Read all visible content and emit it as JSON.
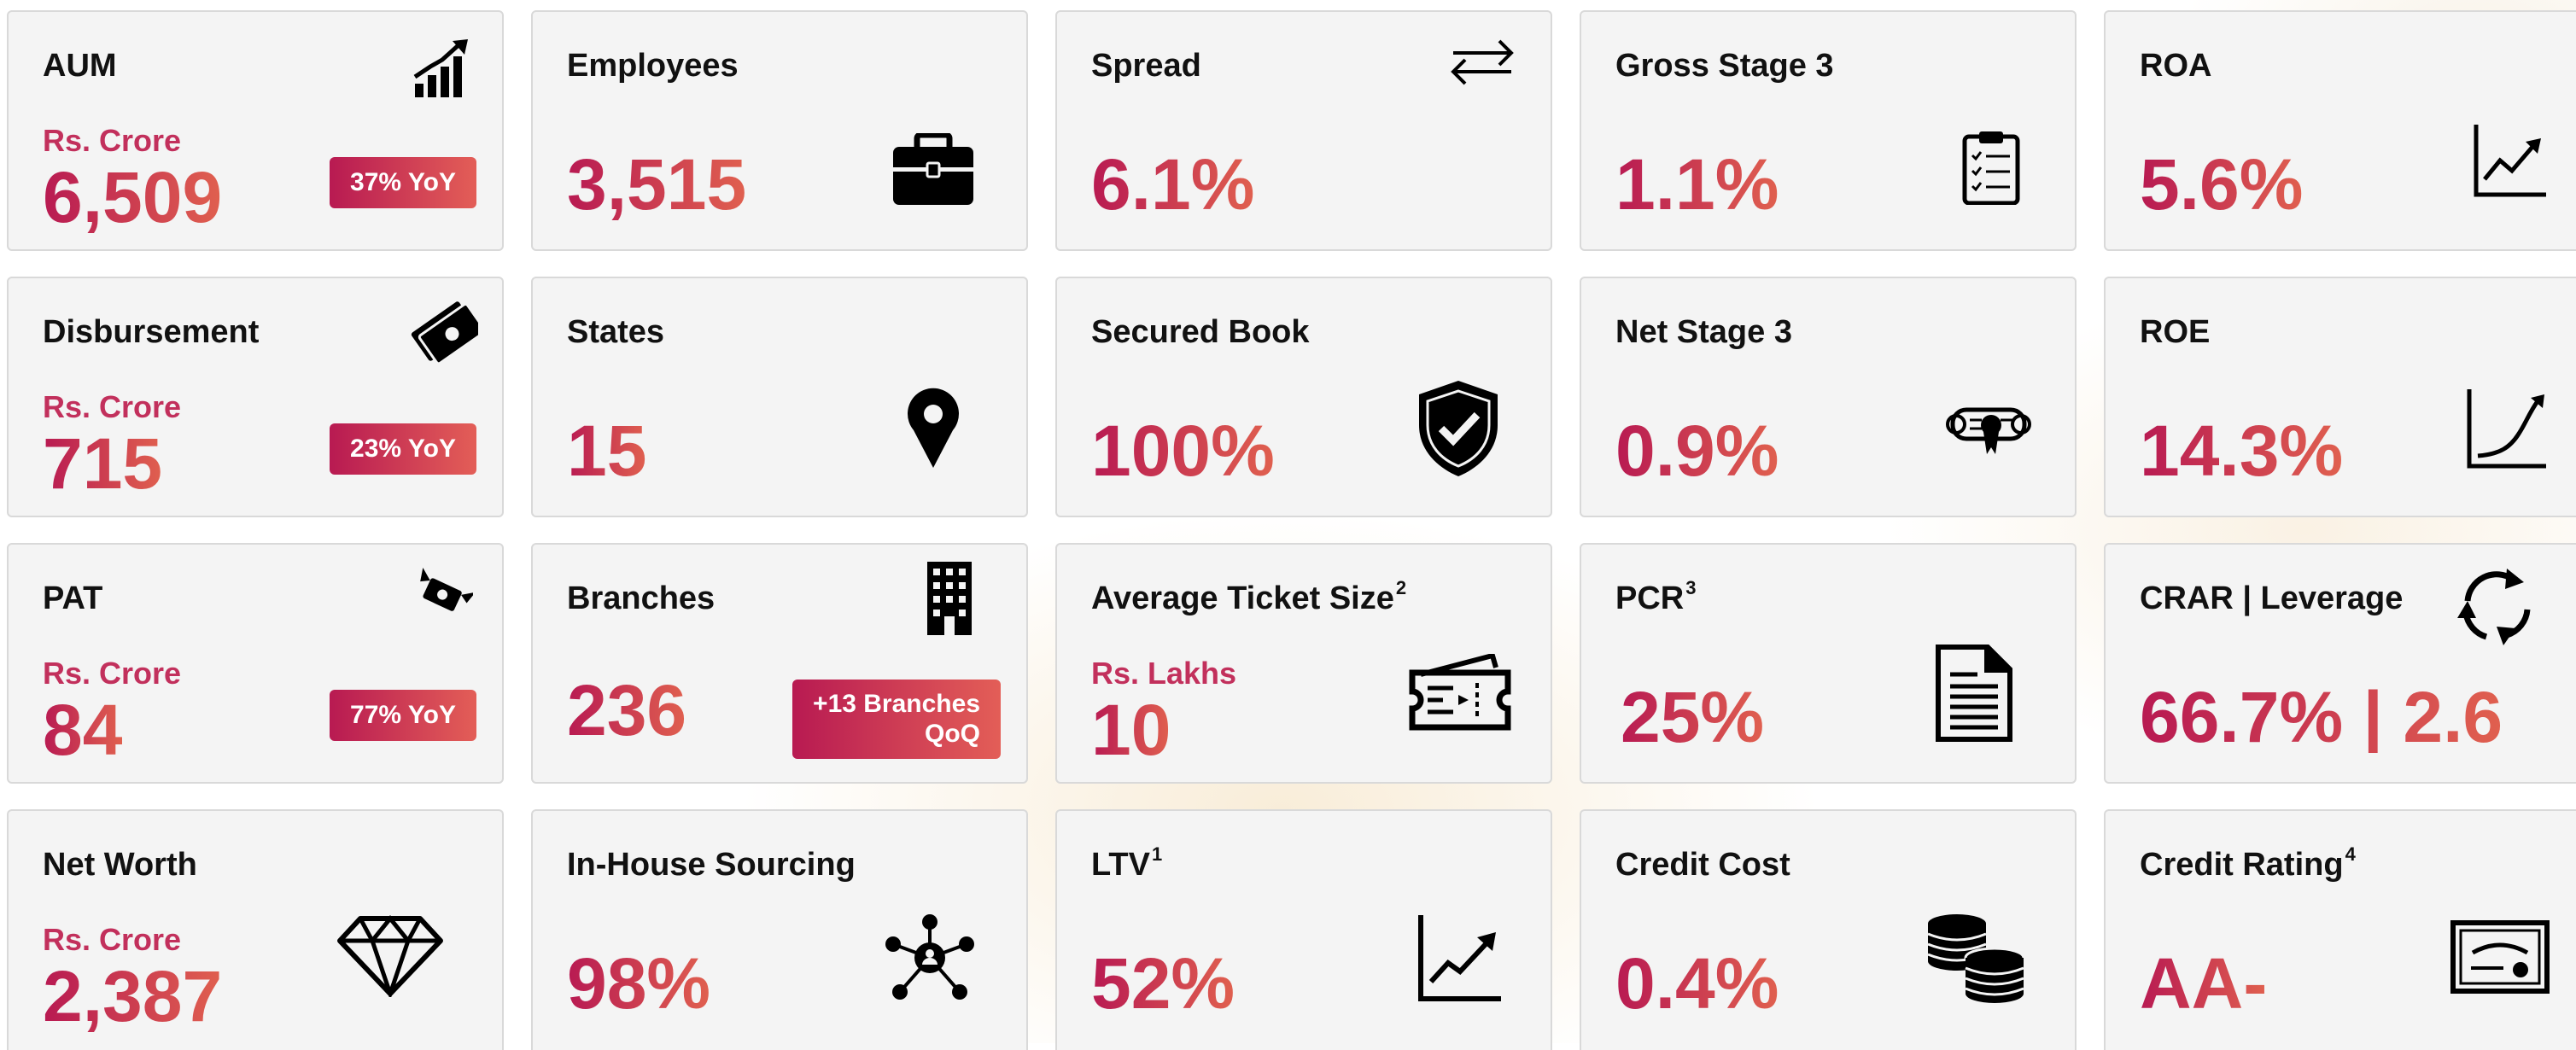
{
  "theme": {
    "accent_start": "#b81a52",
    "accent_end": "#e0604f",
    "card_bg": "#f4f4f4"
  },
  "cards": {
    "aum": {
      "title": "AUM",
      "unit": "Rs. Crore",
      "value": "6,509",
      "badge": "37% YoY",
      "icon": "growth-bar-chart-icon"
    },
    "employees": {
      "title": "Employees",
      "value": "3,515",
      "icon": "briefcase-icon"
    },
    "spread": {
      "title": "Spread",
      "value": "6.1%",
      "icon": "transfer-arrows-icon"
    },
    "gross_stage3": {
      "title": "Gross Stage 3",
      "value": "1.1%",
      "icon": "clipboard-checklist-icon"
    },
    "roa": {
      "title": "ROA",
      "value": "5.6%",
      "icon": "line-chart-icon"
    },
    "disbursement": {
      "title": "Disbursement",
      "unit": "Rs. Crore",
      "value": "715",
      "badge": "23% YoY",
      "icon": "cash-notes-icon"
    },
    "states": {
      "title": "States",
      "value": "15",
      "icon": "map-pin-icon"
    },
    "secured_book": {
      "title": "Secured Book",
      "value": "100%",
      "icon": "shield-check-icon"
    },
    "net_stage3": {
      "title": "Net Stage 3",
      "value": "0.9%",
      "icon": "certificate-scroll-icon"
    },
    "roe": {
      "title": "ROE",
      "value": "14.3%",
      "icon": "growth-curve-icon"
    },
    "pat": {
      "title": "PAT",
      "unit": "Rs. Crore",
      "value": "84",
      "badge": "77% YoY",
      "icon": "flying-money-icon"
    },
    "branches": {
      "title": "Branches",
      "value": "236",
      "badge_line1": "+13 Branches",
      "badge_line2": "QoQ",
      "icon": "office-building-icon"
    },
    "avg_ticket": {
      "title": "Average Ticket Size",
      "sup": "2",
      "unit": "Rs. Lakhs",
      "value": "10",
      "icon": "ticket-icon"
    },
    "pcr": {
      "title": "PCR",
      "sup": "3",
      "value": "25%",
      "icon": "document-icon"
    },
    "crar": {
      "title": "CRAR | Leverage",
      "value": "66.7% | 2.6",
      "icon": "refresh-cycle-icon"
    },
    "net_worth": {
      "title": "Net Worth",
      "unit": "Rs. Crore",
      "value": "2,387",
      "icon": "diamond-icon"
    },
    "in_house": {
      "title": "In-House Sourcing",
      "value": "98%",
      "icon": "network-hub-icon"
    },
    "ltv": {
      "title": "LTV",
      "sup": "1",
      "value": "52%",
      "icon": "trend-chart-icon"
    },
    "credit_cost": {
      "title": "Credit Cost",
      "value": "0.4%",
      "icon": "coin-stacks-icon"
    },
    "credit_rating": {
      "title": "Credit Rating",
      "sup": "4",
      "value": "AA-",
      "icon": "rating-certificate-icon"
    }
  }
}
